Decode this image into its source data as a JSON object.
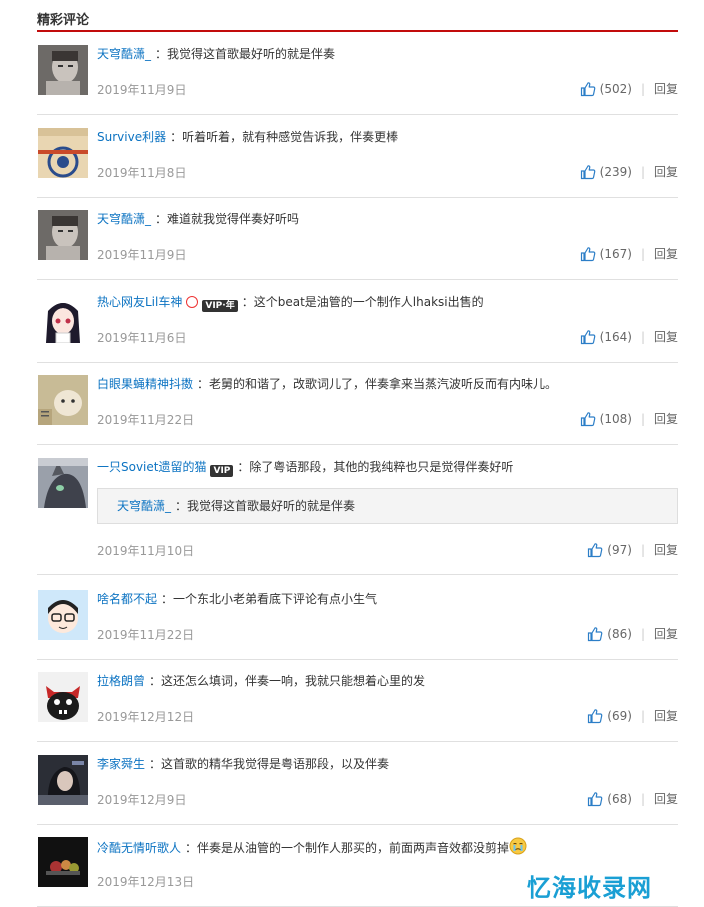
{
  "section_title": "精彩评论",
  "separator": "：",
  "reply_label": "回复",
  "comments": [
    {
      "user": "天穹酷潇_",
      "text": "我觉得这首歌最好听的就是伴奏",
      "date": "2019年11月9日",
      "likes": "(502)"
    },
    {
      "user": "Survive利器",
      "text": "听着听着，就有种感觉告诉我，伴奏更棒",
      "date": "2019年11月8日",
      "likes": "(239)"
    },
    {
      "user": "天穹酷潇_",
      "text": "难道就我觉得伴奏好听吗",
      "date": "2019年11月9日",
      "likes": "(167)"
    },
    {
      "user": "热心网友Lil车神",
      "vip": "VIP·年",
      "text": "这个beat是油管的一个制作人lhaksi出售的",
      "date": "2019年11月6日",
      "likes": "(164)"
    },
    {
      "user": "白眼果蝇精神抖擞",
      "text": "老舅的和谐了，改歌词儿了，伴奏拿来当蒸汽波听反而有内味儿。",
      "date": "2019年11月22日",
      "likes": "(108)"
    },
    {
      "user": "一只Soviet遗留的猫",
      "vip": "VIP",
      "text": "除了粤语那段，其他的我纯粹也只是觉得伴奏好听",
      "quote_user": "天穹酷潇_",
      "quote_text": "我觉得这首歌最好听的就是伴奏",
      "date": "2019年11月10日",
      "likes": "(97)"
    },
    {
      "user": "啥名都不起",
      "text": "一个东北小老弟看底下评论有点小生气",
      "date": "2019年11月22日",
      "likes": "(86)"
    },
    {
      "user": "拉格朗曾",
      "text": "这还怎么填词，伴奏一响，我就只能想着心里的发",
      "date": "2019年12月12日",
      "likes": "(69)"
    },
    {
      "user": "李家舜生",
      "text": "这首歌的精华我觉得是粤语那段，以及伴奏",
      "date": "2019年12月9日",
      "likes": "(68)"
    },
    {
      "user": "冷酷无情听歌人",
      "text": "伴奏是从油管的一个制作人那买的，前面两声音效都没剪掉",
      "date": "2019年12月13日",
      "likes": ""
    }
  ],
  "watermark": "忆海收录网",
  "colors": {
    "username": "#0c73c2",
    "date": "#999999",
    "accent": "#c20c0c",
    "watermark": "#1a9fd4"
  },
  "icons": {
    "like": "thumbs-up-icon",
    "emoji": "crying-emoji-icon"
  }
}
